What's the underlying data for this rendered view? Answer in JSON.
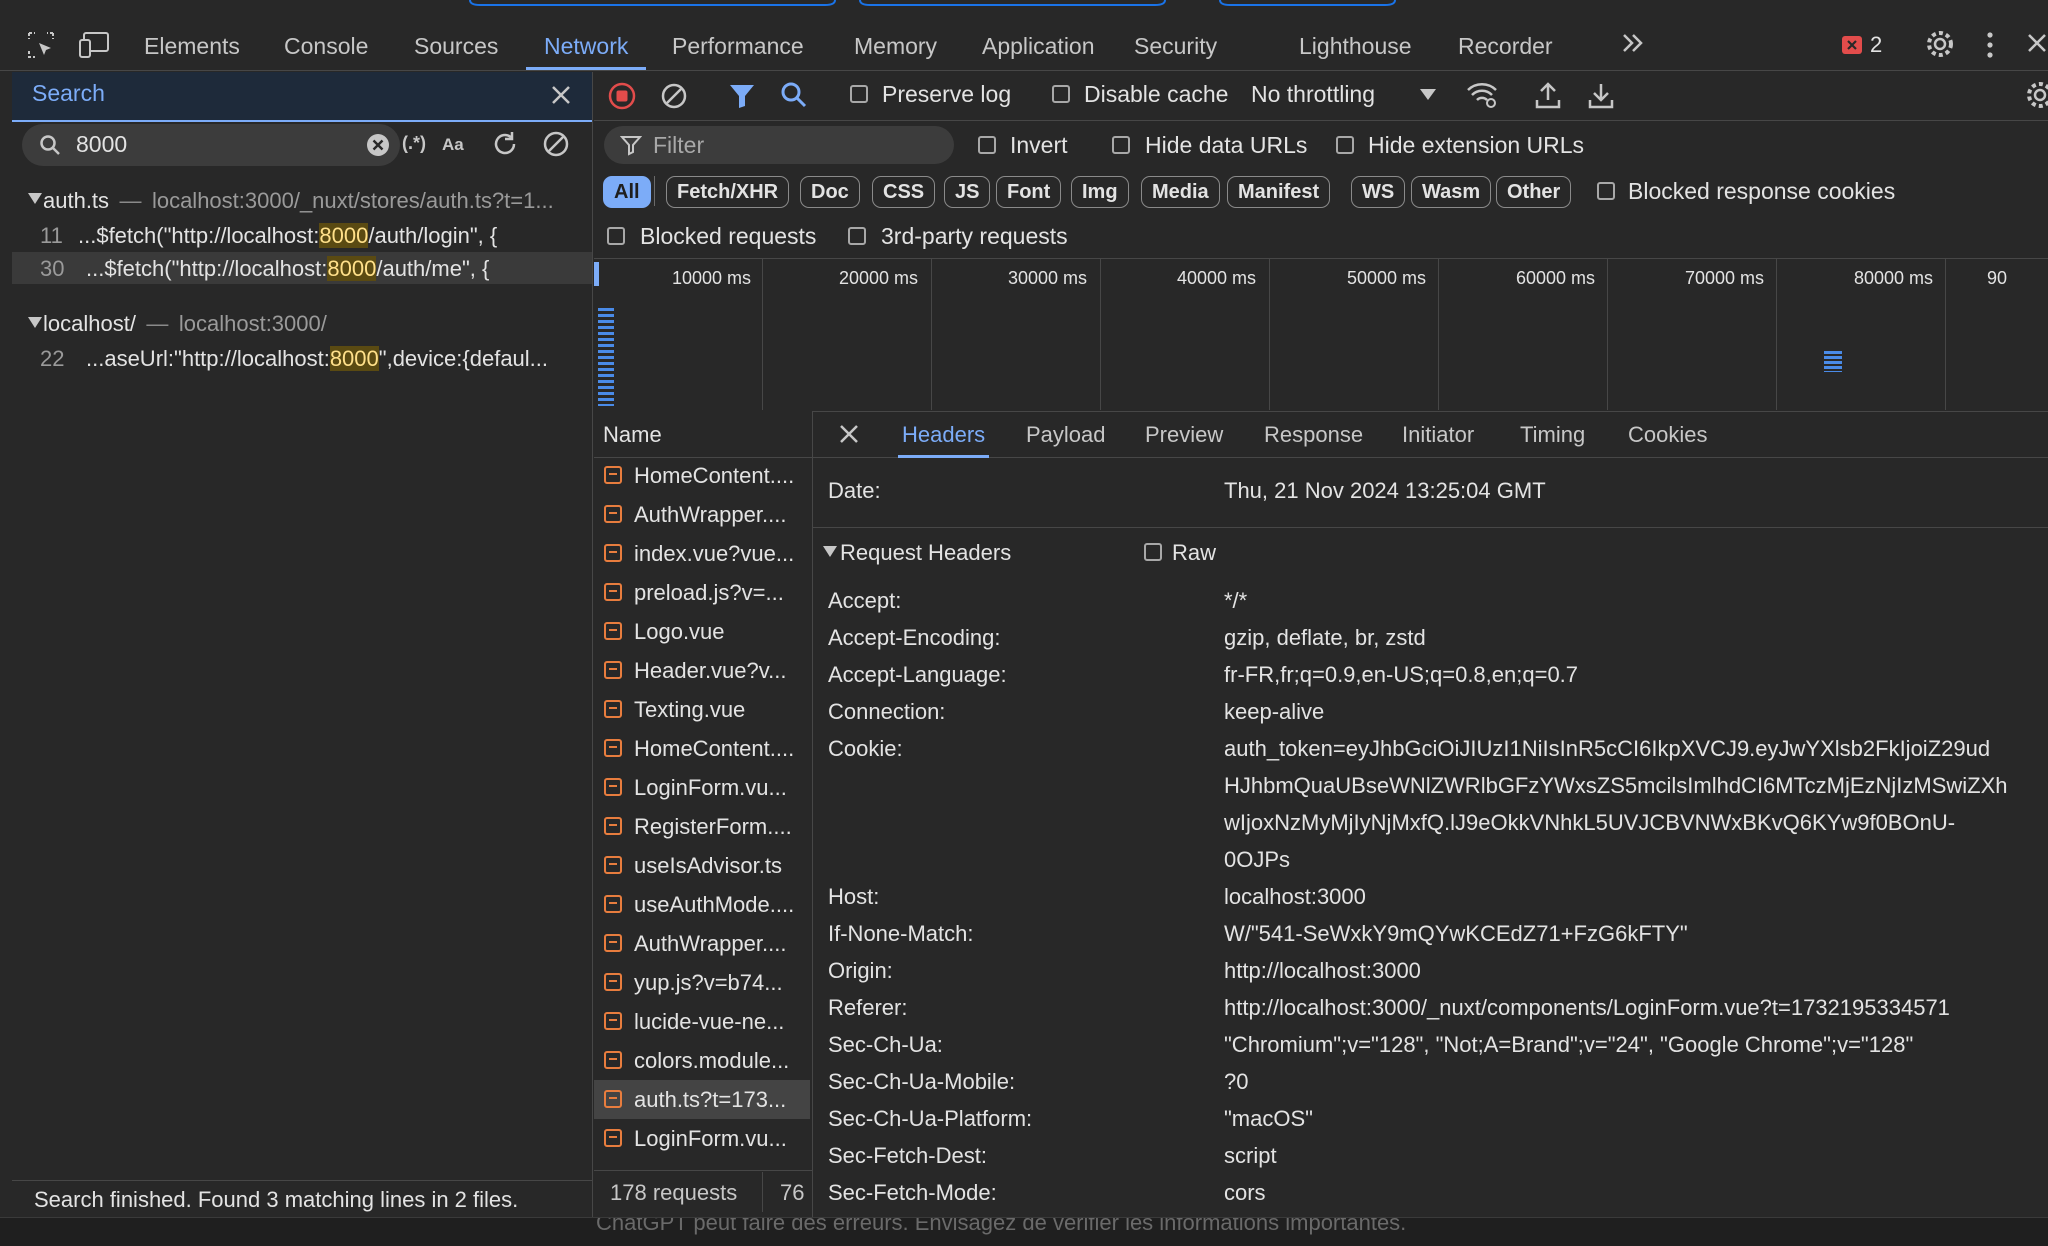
{
  "toolbar_tabs": [
    "Elements",
    "Console",
    "Sources",
    "Network",
    "Performance",
    "Memory",
    "Application",
    "Security",
    "Lighthouse",
    "Recorder"
  ],
  "active_tab": "Network",
  "error_count": "2",
  "search": {
    "title": "Search",
    "query": "8000",
    "regex_label": "(.*)",
    "case_label": "Aa",
    "results": [
      {
        "file": "auth.ts",
        "path": "localhost:3000/_nuxt/stores/auth.ts?t=1...",
        "lines": [
          {
            "num": "11",
            "pre": "...$fetch(\"http://localhost:",
            "match": "8000",
            "post": "/auth/login\", {"
          },
          {
            "num": "30",
            "pre": "...$fetch(\"http://localhost:",
            "match": "8000",
            "post": "/auth/me\", {"
          }
        ]
      },
      {
        "file": "localhost/",
        "path": "localhost:3000/",
        "lines": [
          {
            "num": "22",
            "pre": "...aseUrl:\"http://localhost:",
            "match": "8000",
            "post": "\",device:{defaul..."
          }
        ]
      }
    ],
    "separator": "—",
    "status": "Search finished.  Found 3 matching lines in 2 files."
  },
  "network": {
    "preserve_log": "Preserve log",
    "disable_cache": "Disable cache",
    "throttling": "No throttling",
    "filter_placeholder": "Filter",
    "invert": "Invert",
    "hide_data_urls": "Hide data URLs",
    "hide_extension_urls": "Hide extension URLs",
    "type_filters": [
      "All",
      "Fetch/XHR",
      "Doc",
      "CSS",
      "JS",
      "Font",
      "Img",
      "Media",
      "Manifest",
      "WS",
      "Wasm",
      "Other"
    ],
    "blocked_response_cookies": "Blocked response cookies",
    "blocked_requests": "Blocked requests",
    "third_party": "3rd-party requests",
    "timeline_ticks": [
      "10000 ms",
      "20000 ms",
      "30000 ms",
      "40000 ms",
      "50000 ms",
      "60000 ms",
      "70000 ms",
      "80000 ms",
      "90"
    ],
    "name_header": "Name",
    "requests": [
      "HomeContent....",
      "AuthWrapper....",
      "index.vue?vue...",
      "preload.js?v=...",
      "Logo.vue",
      "Header.vue?v...",
      "Texting.vue",
      "HomeContent....",
      "LoginForm.vu...",
      "RegisterForm....",
      "useIsAdvisor.ts",
      "useAuthMode....",
      "AuthWrapper....",
      "yup.js?v=b74...",
      "lucide-vue-ne...",
      "colors.module...",
      "auth.ts?t=173...",
      "LoginForm.vu..."
    ],
    "selected_request": "auth.ts?t=173...",
    "request_count": "178 requests",
    "transfer_fragment": "76",
    "detail_tabs": [
      "Headers",
      "Payload",
      "Preview",
      "Response",
      "Initiator",
      "Timing",
      "Cookies"
    ],
    "active_detail_tab": "Headers",
    "date_row": {
      "key": "Date:",
      "value": "Thu, 21 Nov 2024 13:25:04 GMT"
    },
    "request_headers_title": "Request Headers",
    "raw_label": "Raw",
    "headers": [
      {
        "key": "Accept:",
        "value": "*/*"
      },
      {
        "key": "Accept-Encoding:",
        "value": "gzip, deflate, br, zstd"
      },
      {
        "key": "Accept-Language:",
        "value": "fr-FR,fr;q=0.9,en-US;q=0.8,en;q=0.7"
      },
      {
        "key": "Connection:",
        "value": "keep-alive"
      },
      {
        "key": "Cookie:",
        "value": "auth_token=eyJhbGciOiJIUzI1NiIsInR5cCI6IkpXVCJ9.eyJwYXlsb2FkIjoiZ29ud"
      },
      {
        "key": "",
        "value": "HJhbmQuaUBseWNlZWRlbGFzYWxsZS5mcilsImlhdCI6MTczMjEzNjIzMSwiZXh"
      },
      {
        "key": "",
        "value": "wIjoxNzMyMjIyNjMxfQ.lJ9eOkkVNhkL5UVJCBVNWxBKvQ6KYw9f0BOnU-"
      },
      {
        "key": "",
        "value": "0OJPs"
      },
      {
        "key": "Host:",
        "value": "localhost:3000"
      },
      {
        "key": "If-None-Match:",
        "value": "W/\"541-SeWxkY9mQYwKCEdZ71+FzG6kFTY\""
      },
      {
        "key": "Origin:",
        "value": "http://localhost:3000"
      },
      {
        "key": "Referer:",
        "value": "http://localhost:3000/_nuxt/components/LoginForm.vue?t=1732195334571"
      },
      {
        "key": "Sec-Ch-Ua:",
        "value": "\"Chromium\";v=\"128\", \"Not;A=Brand\";v=\"24\", \"Google Chrome\";v=\"128\""
      },
      {
        "key": "Sec-Ch-Ua-Mobile:",
        "value": "?0"
      },
      {
        "key": "Sec-Ch-Ua-Platform:",
        "value": "\"macOS\""
      },
      {
        "key": "Sec-Fetch-Dest:",
        "value": "script"
      },
      {
        "key": "Sec-Fetch-Mode:",
        "value": "cors"
      }
    ]
  },
  "page_footer_fragment": "ChatGPT peut faire des erreurs. Envisagez de vérifier les informations importantes.",
  "colors": {
    "accent": "#7cacf8",
    "panel": "#282828",
    "highlight": "#5a4a12",
    "error": "#e24c4b",
    "record": "#e24c4b"
  }
}
